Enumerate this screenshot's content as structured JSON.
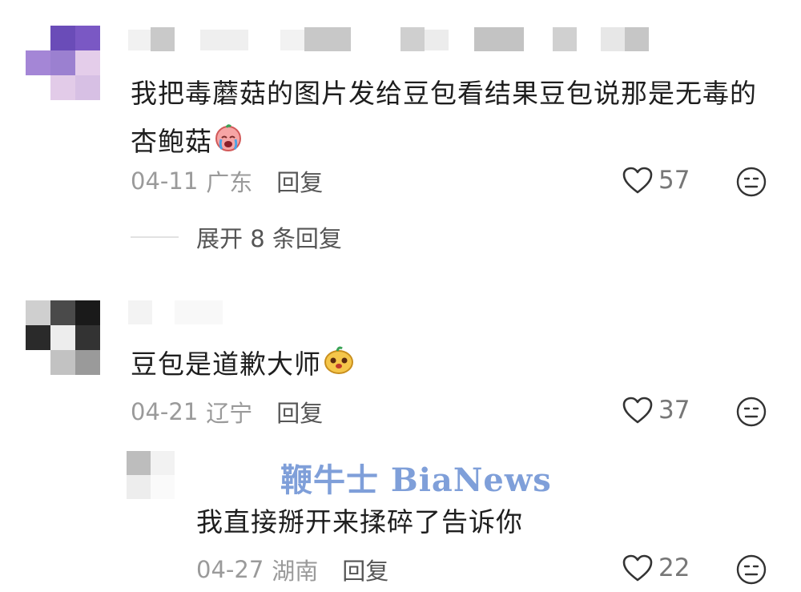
{
  "comments": [
    {
      "text": "我把毒蘑菇的图片发给豆包看结果豆包说那是无毒的杏鲍菇",
      "emoji": "crying-face",
      "date": "04-11",
      "location": "广东",
      "reply_label": "回复",
      "likes": "57",
      "expand_label": "展开 8 条回复"
    },
    {
      "text": "豆包是道歉大师",
      "emoji": "smiling-bean-face",
      "date": "04-21",
      "location": "辽宁",
      "reply_label": "回复",
      "likes": "37"
    }
  ],
  "reply": {
    "text": "我直接掰开来揉碎了告诉你",
    "date": "04-27",
    "location": "湖南",
    "reply_label": "回复",
    "likes": "22"
  },
  "watermark": "鞭牛士 BiaNews",
  "colors": {
    "accent_watermark": "#7f9fd9",
    "meta_gray": "#9a9a9a"
  }
}
